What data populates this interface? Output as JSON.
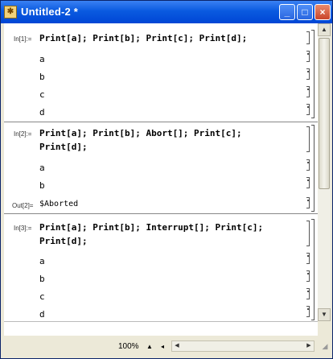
{
  "window": {
    "title": "Untitled-2 *",
    "controls": {
      "minimize": "_",
      "maximize": "□",
      "close": "×"
    }
  },
  "notebook": {
    "cell1": {
      "label": "In[1]:=",
      "input": "Print[a]; Print[b]; Print[c]; Print[d];",
      "outputs": [
        "a",
        "b",
        "c",
        "d"
      ]
    },
    "cell2": {
      "label": "In[2]:=",
      "input1": "Print[a]; Print[b]; Abort[]; Print[c];",
      "input2": "Print[d];",
      "outputs": [
        "a",
        "b"
      ],
      "out_label": "Out[2]=",
      "out_value": "$Aborted"
    },
    "cell3": {
      "label": "In[3]:=",
      "input1": "Print[a]; Print[b]; Interrupt[]; Print[c];",
      "input2": "Print[d];",
      "outputs": [
        "a",
        "b",
        "c",
        "d"
      ]
    }
  },
  "status": {
    "zoom": "100%"
  },
  "icons": {
    "app": "mathematica-icon",
    "scroll_up": "arrow-up-icon",
    "scroll_down": "arrow-down-icon",
    "scroll_left": "arrow-left-icon",
    "scroll_right": "arrow-right-icon"
  }
}
